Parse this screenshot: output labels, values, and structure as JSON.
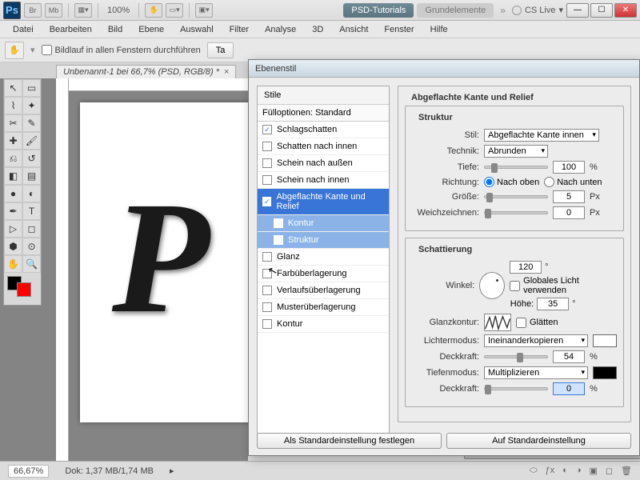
{
  "app": {
    "zoom_pct": "100%",
    "workspace_tabs": [
      "PSD-Tutorials",
      "Grundelemente"
    ],
    "cs_live": "CS Live"
  },
  "menubar": [
    "Datei",
    "Bearbeiten",
    "Bild",
    "Ebene",
    "Auswahl",
    "Filter",
    "Analyse",
    "3D",
    "Ansicht",
    "Fenster",
    "Hilfe"
  ],
  "optbar": {
    "scroll_all": "Bildlauf in allen Fenstern durchführen",
    "btn_ta": "Ta"
  },
  "document_tab": "Unbenannt-1 bei 66,7% (PSD, RGB/8) *",
  "status": {
    "zoom": "66,67%",
    "doc_size": "Dok: 1,37 MB/1,74 MB"
  },
  "dialog": {
    "title": "Ebenenstil",
    "styles_header": "Stile",
    "fill_options": "Fülloptionen: Standard",
    "style_list": [
      {
        "label": "Schlagschatten",
        "checked": true,
        "selected": false
      },
      {
        "label": "Schatten nach innen",
        "checked": false,
        "selected": false
      },
      {
        "label": "Schein nach außen",
        "checked": false,
        "selected": false
      },
      {
        "label": "Schein nach innen",
        "checked": false,
        "selected": false
      },
      {
        "label": "Abgeflachte Kante und Relief",
        "checked": true,
        "selected": true
      },
      {
        "label": "Kontur",
        "checked": false,
        "selected": false,
        "sub": true
      },
      {
        "label": "Struktur",
        "checked": false,
        "selected": false,
        "sub": true
      },
      {
        "label": "Glanz",
        "checked": false,
        "selected": false
      },
      {
        "label": "Farbüberlagerung",
        "checked": false,
        "selected": false
      },
      {
        "label": "Verlaufsüberlagerung",
        "checked": false,
        "selected": false
      },
      {
        "label": "Musterüberlagerung",
        "checked": false,
        "selected": false
      },
      {
        "label": "Kontur",
        "checked": false,
        "selected": false
      }
    ],
    "main_panel_title": "Abgeflachte Kante und Relief",
    "struktur": {
      "legend": "Struktur",
      "stil_label": "Stil:",
      "stil_value": "Abgeflachte Kante innen",
      "technik_label": "Technik:",
      "technik_value": "Abrunden",
      "tiefe_label": "Tiefe:",
      "tiefe_value": "100",
      "tiefe_unit": "%",
      "richtung_label": "Richtung:",
      "richtung_up": "Nach oben",
      "richtung_down": "Nach unten",
      "groesse_label": "Größe:",
      "groesse_value": "5",
      "groesse_unit": "Px",
      "weich_label": "Weichzeichnen:",
      "weich_value": "0",
      "weich_unit": "Px"
    },
    "schatt": {
      "legend": "Schattierung",
      "winkel_label": "Winkel:",
      "winkel_value": "120",
      "winkel_unit": "°",
      "global_light": "Globales Licht verwenden",
      "hoehe_label": "Höhe:",
      "hoehe_value": "35",
      "hoehe_unit": "°",
      "glanzkontur_label": "Glanzkontur:",
      "glaetten": "Glätten",
      "lichtermodus_label": "Lichtermodus:",
      "lichtermodus_value": "Ineinanderkopieren",
      "deck1_label": "Deckkraft:",
      "deck1_value": "54",
      "deck1_unit": "%",
      "tiefenmodus_label": "Tiefenmodus:",
      "tiefenmodus_value": "Multiplizieren",
      "deck2_label": "Deckkraft:",
      "deck2_value": "0",
      "deck2_unit": "%"
    },
    "buttons": {
      "default": "Als Standardeinstellung festlegen",
      "reset": "Auf Standardeinstellung"
    }
  }
}
